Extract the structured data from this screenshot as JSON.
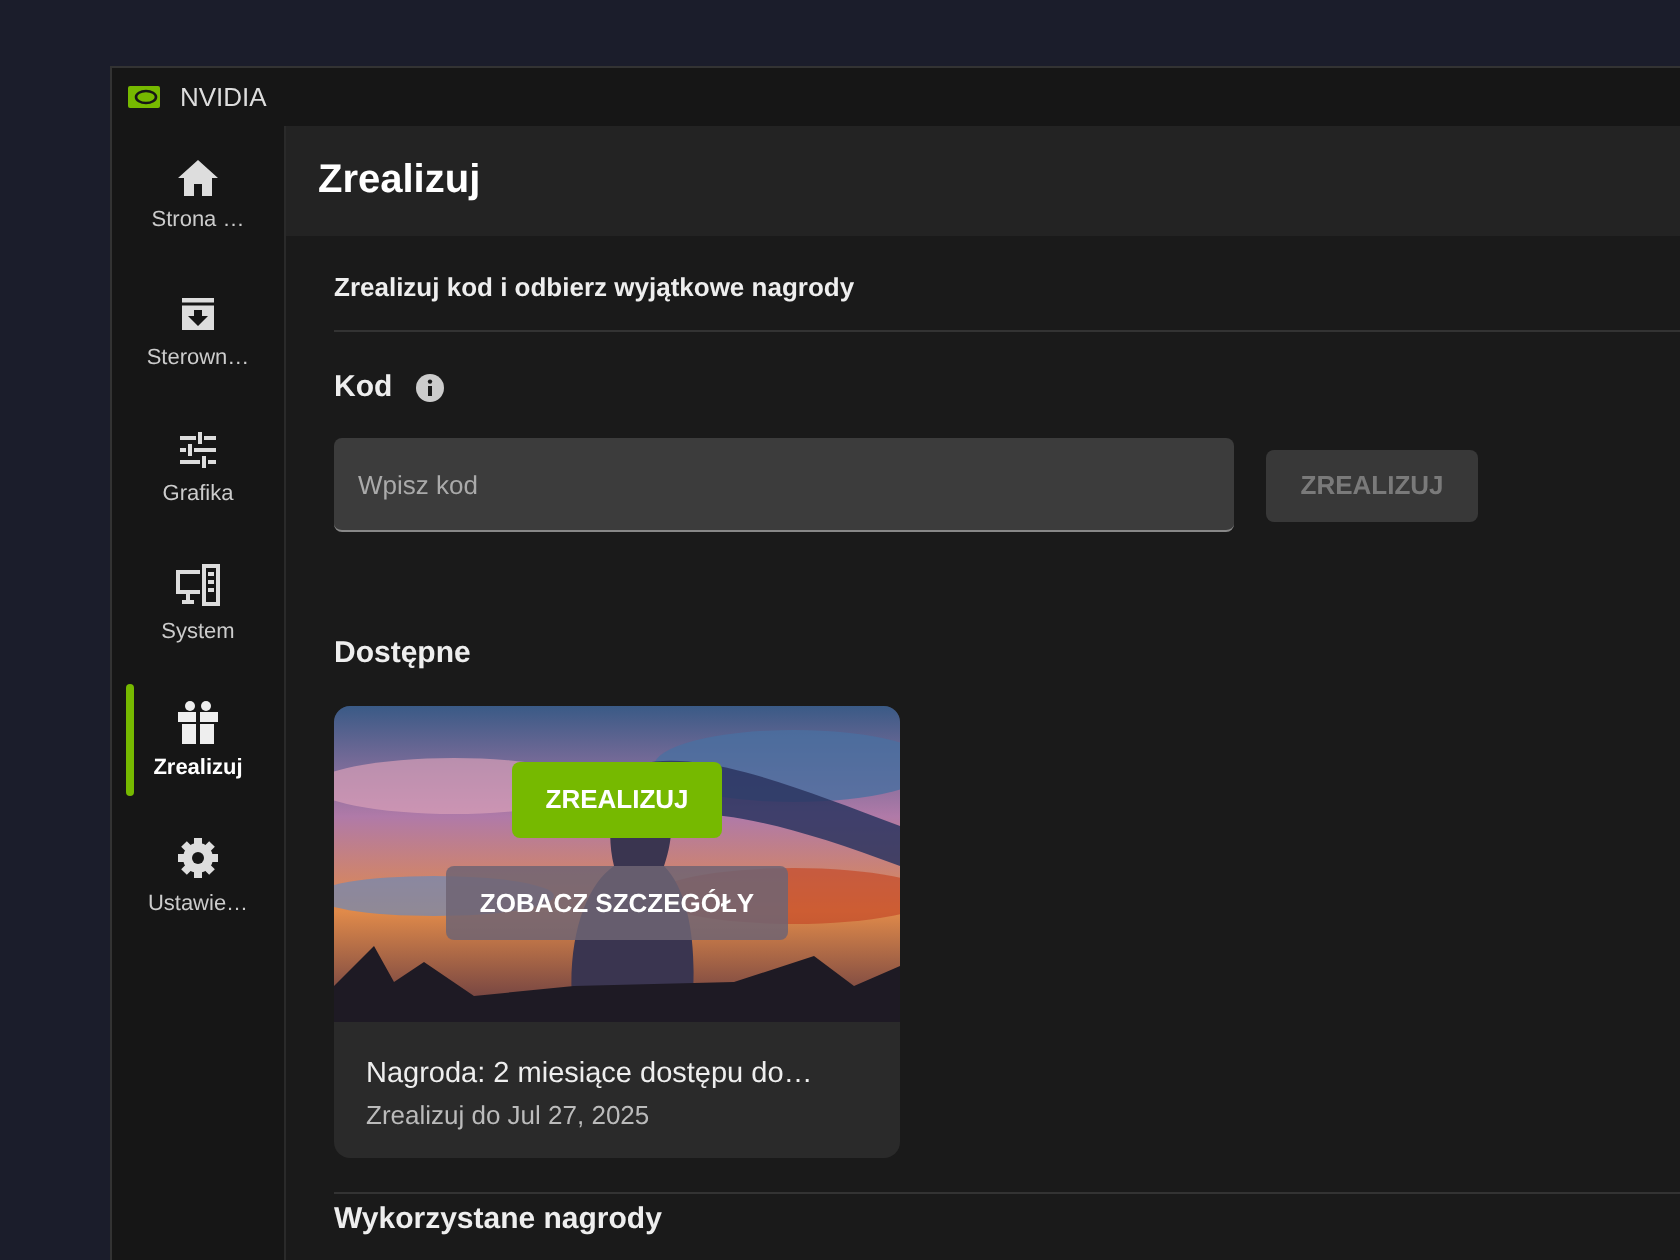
{
  "window": {
    "title": "NVIDIA"
  },
  "sidebar": {
    "items": [
      {
        "label": "Strona …",
        "kind": "home",
        "selected": false
      },
      {
        "label": "Sterown…",
        "kind": "download",
        "selected": false
      },
      {
        "label": "Grafika",
        "kind": "sliders",
        "selected": false
      },
      {
        "label": "System",
        "kind": "system",
        "selected": false
      },
      {
        "label": "Zrealizuj",
        "kind": "gift",
        "selected": true
      },
      {
        "label": "Ustawie…",
        "kind": "gear",
        "selected": false
      }
    ]
  },
  "page": {
    "title": "Zrealizuj",
    "subtitle": "Zrealizuj kod i odbierz wyjątkowe nagrody"
  },
  "code": {
    "label": "Kod",
    "placeholder": "Wpisz kod",
    "button": {
      "label": "ZREALIZUJ",
      "disabled": true
    }
  },
  "available": {
    "heading": "Dostępne",
    "cards": [
      {
        "kind": "picture",
        "title": "Nagroda: 2 miesiące dostępu do…",
        "expiry": "Zrealizuj do Jul 27, 2025",
        "redeem": "ZREALIZUJ",
        "details": "ZOBACZ SZCZEGÓŁY"
      }
    ]
  },
  "redeemed": {
    "heading": "Wykorzystane nagrody"
  }
}
